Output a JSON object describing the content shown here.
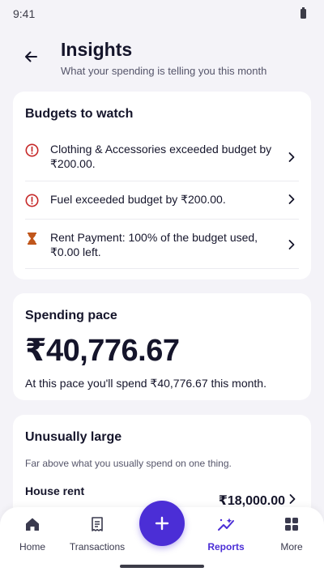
{
  "status_bar": {
    "time": "9:41"
  },
  "header": {
    "title": "Insights",
    "subtitle": "What your spending is telling you this month"
  },
  "budgets": {
    "title": "Budgets to watch",
    "items": [
      {
        "text": "Clothing & Accessories exceeded budget by ₹200.00.",
        "icon": "alert-circle-icon",
        "status_color": "#c62828"
      },
      {
        "text": "Fuel exceeded budget by ₹200.00.",
        "icon": "alert-circle-icon",
        "status_color": "#c62828"
      },
      {
        "text": "Rent Payment: 100% of the budget used, ₹0.00 left.",
        "icon": "hourglass-icon",
        "status_color": "#c0561b"
      }
    ]
  },
  "pace": {
    "title": "Spending pace",
    "amount": "₹40,776.67",
    "description": "At this pace you'll spend ₹40,776.67 this month."
  },
  "unusually_large": {
    "title": "Unusually large",
    "description": "Far above what you usually spend on one thing.",
    "items": [
      {
        "name": "House rent",
        "amount": "₹18,000.00"
      }
    ]
  },
  "bottom_nav": {
    "items": [
      {
        "label": "Home",
        "icon": "home-icon"
      },
      {
        "label": "Transactions",
        "icon": "receipt-icon"
      },
      {
        "label": "Reports",
        "icon": "trending-icon",
        "active": true
      },
      {
        "label": "More",
        "icon": "grid-icon"
      }
    ],
    "fab_icon": "plus-icon"
  },
  "colors": {
    "accent": "#4b2ed6",
    "background": "#f4f3f8",
    "card": "#ffffff",
    "text_primary": "#15152b",
    "text_secondary": "#55556a"
  }
}
